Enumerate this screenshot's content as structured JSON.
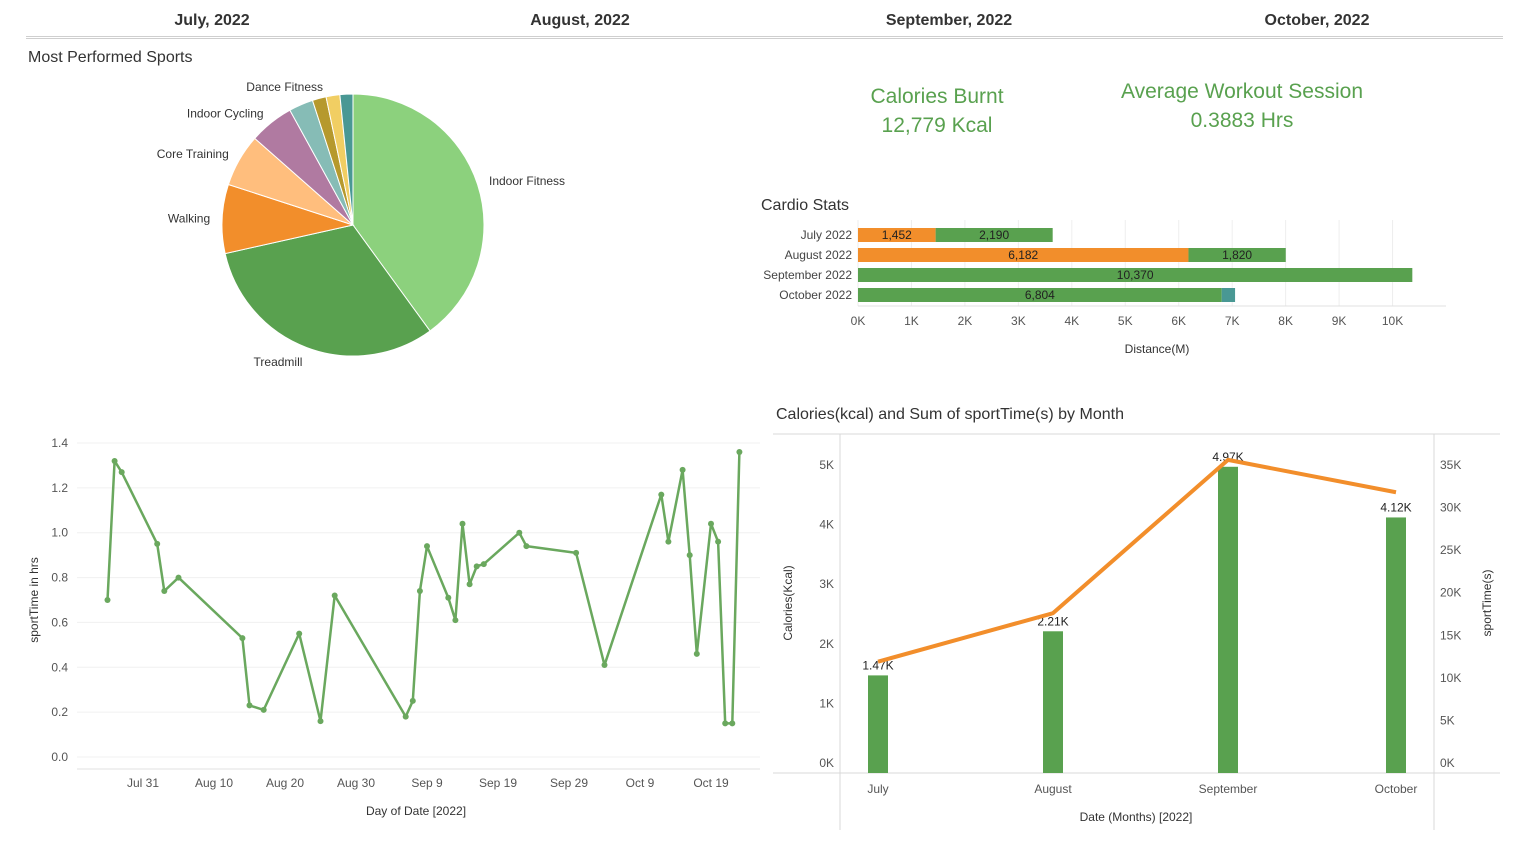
{
  "header": {
    "months": [
      "July, 2022",
      "August, 2022",
      "September, 2022",
      "October, 2022"
    ]
  },
  "kpis": {
    "calories_title": "Calories Burnt",
    "calories_value": "12,779 Kcal",
    "session_title": "Average Workout Session",
    "session_value": "0.3883 Hrs"
  },
  "colors": {
    "green": "#59a14f",
    "light_green": "#8cd17d",
    "orange": "#f28e2b",
    "light_orange": "#ffbe7d",
    "purple": "#b07aa1",
    "teal": "#86bcb6",
    "olive": "#b6992d",
    "yellow": "#f1ce63",
    "blue": "#499894",
    "line_green": "#6aa85e"
  },
  "chart_data": [
    {
      "id": "pie",
      "type": "pie",
      "title": "Most Performed Sports",
      "slices": [
        {
          "label": "Indoor Fitness",
          "value": 40.0,
          "color": "#8cd17d"
        },
        {
          "label": "Treadmill",
          "value": 31.5,
          "color": "#59a14f"
        },
        {
          "label": "Walking",
          "value": 8.5,
          "color": "#f28e2b"
        },
        {
          "label": "Core Training",
          "value": 6.5,
          "color": "#ffbe7d"
        },
        {
          "label": "Indoor Cycling",
          "value": 5.5,
          "color": "#b07aa1"
        },
        {
          "label": "",
          "value": 3.0,
          "color": "#86bcb6"
        },
        {
          "label": "Dance Fitness",
          "value": 1.7,
          "color": "#b6992d"
        },
        {
          "label": "",
          "value": 1.7,
          "color": "#f1ce63"
        },
        {
          "label": "",
          "value": 1.6,
          "color": "#499894"
        }
      ]
    },
    {
      "id": "cardio",
      "type": "bar",
      "orientation": "horizontal-stacked",
      "title": "Cardio Stats",
      "xlabel": "Distance(M)",
      "xlim": [
        0,
        11000
      ],
      "xticks": [
        0,
        1000,
        2000,
        3000,
        4000,
        5000,
        6000,
        7000,
        8000,
        9000,
        10000
      ],
      "xtick_labels": [
        "0K",
        "1K",
        "2K",
        "3K",
        "4K",
        "5K",
        "6K",
        "7K",
        "8K",
        "9K",
        "10K"
      ],
      "categories": [
        "July 2022",
        "August 2022",
        "September 2022",
        "October 2022"
      ],
      "rows": [
        {
          "segments": [
            {
              "value": 1452,
              "color": "#f28e2b",
              "label": "1,452"
            },
            {
              "value": 2190,
              "color": "#59a14f",
              "label": "2,190"
            }
          ]
        },
        {
          "segments": [
            {
              "value": 6182,
              "color": "#f28e2b",
              "label": "6,182"
            },
            {
              "value": 1820,
              "color": "#59a14f",
              "label": "1,820"
            }
          ]
        },
        {
          "segments": [
            {
              "value": 10370,
              "color": "#59a14f",
              "label": "10,370"
            }
          ]
        },
        {
          "segments": [
            {
              "value": 6804,
              "color": "#59a14f",
              "label": "6,804"
            },
            {
              "value": 250,
              "color": "#499894",
              "label": ""
            }
          ]
        }
      ]
    },
    {
      "id": "sporttime",
      "type": "line",
      "title": "",
      "xlabel": "Day of Date [2022]",
      "ylabel": "sportTime in hrs",
      "ylim": [
        0,
        1.4
      ],
      "yticks": [
        0,
        0.2,
        0.4,
        0.6,
        0.8,
        1.0,
        1.2,
        1.4
      ],
      "ytick_labels": [
        "0.0",
        "0.2",
        "0.4",
        "0.6",
        "0.8",
        "1.0",
        "1.2",
        "1.4"
      ],
      "xticks": [
        "2022-07-31",
        "2022-08-10",
        "2022-08-20",
        "2022-08-30",
        "2022-09-09",
        "2022-09-19",
        "2022-09-29",
        "2022-10-09",
        "2022-10-19"
      ],
      "xtick_labels": [
        "Jul 31",
        "Aug 10",
        "Aug 20",
        "Aug 30",
        "Sep 9",
        "Sep 19",
        "Sep 29",
        "Oct 9",
        "Oct 19"
      ],
      "series": [
        {
          "color": "#6aa85e",
          "points": [
            [
              "2022-07-26",
              0.7
            ],
            [
              "2022-07-27",
              1.32
            ],
            [
              "2022-07-28",
              1.27
            ],
            [
              "2022-08-02",
              0.95
            ],
            [
              "2022-08-03",
              0.74
            ],
            [
              "2022-08-05",
              0.8
            ],
            [
              "2022-08-14",
              0.53
            ],
            [
              "2022-08-15",
              0.23
            ],
            [
              "2022-08-17",
              0.21
            ],
            [
              "2022-08-22",
              0.55
            ],
            [
              "2022-08-25",
              0.16
            ],
            [
              "2022-08-27",
              0.72
            ],
            [
              "2022-09-06",
              0.18
            ],
            [
              "2022-09-07",
              0.25
            ],
            [
              "2022-09-08",
              0.74
            ],
            [
              "2022-09-09",
              0.94
            ],
            [
              "2022-09-12",
              0.71
            ],
            [
              "2022-09-13",
              0.61
            ],
            [
              "2022-09-14",
              1.04
            ],
            [
              "2022-09-15",
              0.77
            ],
            [
              "2022-09-16",
              0.85
            ],
            [
              "2022-09-17",
              0.86
            ],
            [
              "2022-09-22",
              1.0
            ],
            [
              "2022-09-23",
              0.94
            ],
            [
              "2022-09-30",
              0.91
            ],
            [
              "2022-10-04",
              0.41
            ],
            [
              "2022-10-12",
              1.17
            ],
            [
              "2022-10-13",
              0.96
            ],
            [
              "2022-10-15",
              1.28
            ],
            [
              "2022-10-16",
              0.9
            ],
            [
              "2022-10-17",
              0.46
            ],
            [
              "2022-10-19",
              1.04
            ],
            [
              "2022-10-20",
              0.96
            ],
            [
              "2022-10-21",
              0.15
            ],
            [
              "2022-10-22",
              0.15
            ],
            [
              "2022-10-23",
              1.36
            ]
          ]
        }
      ]
    },
    {
      "id": "calories",
      "type": "bar",
      "title": "Calories(kcal)  and Sum of sportTime(s) by Month",
      "xlabel": "Date (Months) [2022]",
      "ylabel": "Calories(Kcal)",
      "y2label": "sportTime(s)",
      "categories": [
        "July",
        "August",
        "September",
        "October"
      ],
      "ylim": [
        0,
        5000
      ],
      "yticks": [
        0,
        1000,
        2000,
        3000,
        4000,
        5000
      ],
      "ytick_labels": [
        "0K",
        "1K",
        "2K",
        "3K",
        "4K",
        "5K"
      ],
      "y2lim": [
        0,
        35000
      ],
      "y2ticks": [
        0,
        5000,
        10000,
        15000,
        20000,
        25000,
        30000,
        35000
      ],
      "y2tick_labels": [
        "0K",
        "5K",
        "10K",
        "15K",
        "20K",
        "25K",
        "30K",
        "35K"
      ],
      "series": [
        {
          "kind": "bar",
          "axis": "left",
          "color": "#59a14f",
          "values": [
            1470,
            2210,
            4970,
            4120
          ],
          "labels": [
            "1.47K",
            "2.21K",
            "4.97K",
            "4.12K"
          ]
        },
        {
          "kind": "line",
          "axis": "right",
          "color": "#f28e2b",
          "values": [
            11900,
            17600,
            35600,
            31800
          ]
        }
      ]
    }
  ]
}
